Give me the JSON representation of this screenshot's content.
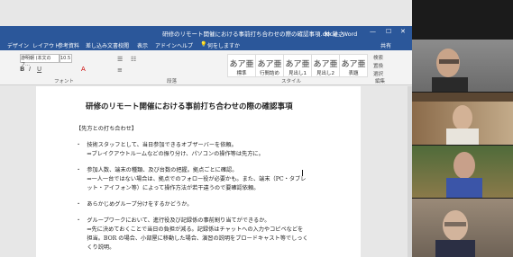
{
  "window": {
    "doc_title": "研修のリモート開催における事前打ち合わせの際の確認事項.docx - Word",
    "user": "林 雄之"
  },
  "tabs": [
    "デザイン",
    "レイアウト",
    "参考資料",
    "差し込み文書",
    "校閲",
    "表示",
    "アドイン",
    "ヘルプ",
    "何をしますか"
  ],
  "share_label": "共有",
  "ribbon": {
    "font_name": "游明朝 (本文のフ…",
    "font_size": "10.5",
    "group_font": "フォント",
    "group_paragraph": "段落",
    "group_styles": "スタイル",
    "group_edit": "編集",
    "styles": [
      {
        "preview": "あア亜",
        "name": "標準"
      },
      {
        "preview": "あア亜",
        "name": "行間詰め"
      },
      {
        "preview": "あア亜",
        "name": "見出し1"
      },
      {
        "preview": "あア亜",
        "name": "見出し2"
      },
      {
        "preview": "あア亜",
        "name": "表題"
      }
    ],
    "edit": [
      "検索",
      "置換",
      "選択"
    ]
  },
  "document": {
    "title": "研修のリモート開催における事前打ち合わせの際の確認事項",
    "lines": [
      "【先方との打ち合わせ】",
      "・　技術スタッフとして、当日参加できるオブザーバーを依頼。",
      "　　⇒ブレイクアウトルームなどの振り分け、パソコンの操作等は先方に。",
      "・　参加人数、端末の種類、及び台数の把握。拠点ごとに確認。",
      "　　⇒一人一台ではない場合は、拠点でのフォロー役が必要かも。また、端末（PC・タブレ",
      "　　ット・アイフォン等）によって操作方法が若干違うので要確認依頼。",
      "・　あらかじめグループ分けをするかどうか。",
      "・　グループワークにおいて、進行役及び記録係の事前割り当てができるか。",
      "　　⇒先に決めておくことで当日の負担が減る。記録係はチャットへの入力やコピペなどを",
      "　　担当。BOR の場合、小部屋に移動した場合、演習の説明をブロードキャスト等でしっく",
      "　　くり説明。"
    ]
  },
  "cursor_glyph": "I"
}
